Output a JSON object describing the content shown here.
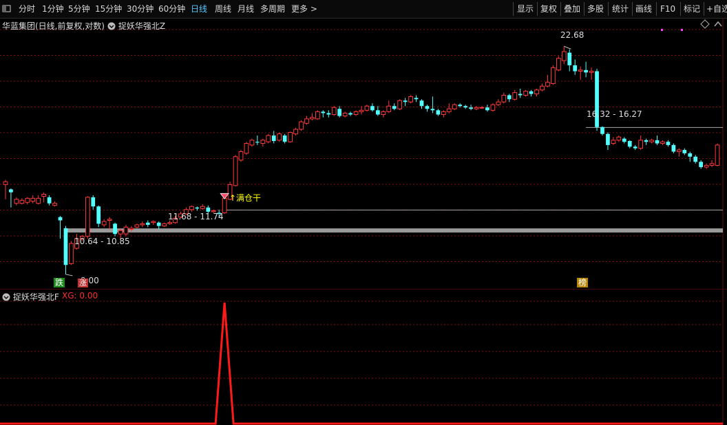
{
  "toolbar": {
    "periods": [
      "分时",
      "1分钟",
      "5分钟",
      "15分钟",
      "30分钟",
      "60分钟",
      "日线",
      "周线",
      "月线",
      "多周期",
      "更多"
    ],
    "active": "日线",
    "more_arrow": ">",
    "tools": [
      "显示",
      "复权",
      "叠加",
      "多股",
      "统计",
      "画线",
      "F10",
      "标记",
      "+自选"
    ]
  },
  "main": {
    "stock_title": "华蓝集团(日线,前复权,对数)",
    "indicator_name": "捉妖华强北Z",
    "labels": {
      "high": "22.68",
      "range_a": "16.32 - 16.27",
      "range_b": "11.68 - 11.74",
      "range_c": "10.64 - 10.85",
      "low": "9.00",
      "signal": "↑满仓干",
      "badge_die": "跌",
      "badge_zhang": "涨",
      "badge_bang": "榜"
    }
  },
  "sub": {
    "indicator_name": "捉妖华强北F",
    "value_label": "XG: 0.00"
  },
  "colors": {
    "up": "#ff3b3b",
    "down": "#54ffff",
    "grid": "#8a1010",
    "active_tab": "#56c8ff",
    "signal_text": "#ffff00",
    "xg_label": "#ff2d2d"
  },
  "chart_data": {
    "type": "candlestick",
    "scale": "log",
    "ylim": [
      8.8,
      24.0
    ],
    "candles": [
      [
        12.95,
        13.1,
        12.2,
        13.2
      ],
      [
        12.7,
        12.55,
        11.8,
        12.75
      ],
      [
        12.0,
        12.2,
        11.9,
        12.3
      ],
      [
        12.0,
        12.15,
        11.95,
        12.25
      ],
      [
        12.05,
        12.25,
        11.95,
        12.3
      ],
      [
        12.1,
        12.25,
        12.0,
        12.4
      ],
      [
        12.0,
        12.25,
        11.95,
        12.4
      ],
      [
        12.35,
        12.45,
        12.05,
        12.55
      ],
      [
        12.3,
        12.0,
        11.9,
        12.4
      ],
      [
        11.9,
        12.0,
        11.85,
        12.1
      ],
      [
        11.35,
        11.2,
        10.4,
        11.4
      ],
      [
        10.85,
        9.35,
        9.0,
        10.95
      ],
      [
        9.4,
        10.2,
        9.35,
        10.3
      ],
      [
        10.0,
        10.4,
        9.95,
        10.6
      ],
      [
        10.4,
        10.5,
        10.3,
        10.55
      ],
      [
        10.5,
        12.3,
        10.4,
        12.35
      ],
      [
        12.3,
        11.85,
        11.7,
        12.4
      ],
      [
        11.85,
        11.05,
        10.9,
        11.9
      ],
      [
        11.0,
        11.15,
        10.9,
        11.25
      ],
      [
        11.2,
        11.25,
        10.8,
        11.35
      ],
      [
        11.05,
        10.6,
        10.5,
        11.1
      ],
      [
        10.6,
        10.75,
        10.4,
        10.85
      ],
      [
        10.6,
        10.9,
        10.5,
        11.0
      ],
      [
        10.8,
        10.85,
        10.7,
        10.95
      ],
      [
        10.9,
        11.0,
        10.85,
        11.05
      ],
      [
        11.0,
        11.05,
        10.9,
        11.15
      ],
      [
        11.1,
        11.0,
        10.9,
        11.2
      ],
      [
        11.1,
        11.15,
        11.0,
        11.2
      ],
      [
        11.1,
        10.95,
        10.8,
        11.15
      ],
      [
        10.95,
        11.05,
        10.9,
        11.1
      ],
      [
        11.05,
        11.1,
        11.0,
        11.2
      ],
      [
        11.1,
        11.3,
        11.05,
        11.4
      ],
      [
        11.35,
        11.5,
        11.3,
        11.6
      ],
      [
        11.5,
        11.7,
        11.45,
        11.8
      ],
      [
        11.7,
        11.85,
        11.6,
        11.9
      ],
      [
        11.8,
        11.75,
        11.65,
        11.85
      ],
      [
        11.75,
        11.85,
        11.7,
        11.95
      ],
      [
        11.8,
        11.6,
        11.5,
        11.9
      ],
      [
        11.6,
        11.65,
        11.55,
        11.7
      ],
      [
        11.55,
        11.5,
        11.35,
        11.7
      ],
      [
        11.55,
        12.25,
        11.5,
        12.35
      ],
      [
        12.2,
        12.95,
        12.15,
        13.1
      ],
      [
        12.9,
        14.5,
        12.85,
        14.6
      ],
      [
        14.3,
        14.8,
        14.2,
        14.9
      ],
      [
        14.7,
        15.3,
        14.6,
        15.4
      ],
      [
        15.2,
        15.5,
        15.1,
        15.6
      ],
      [
        15.4,
        15.35,
        15.2,
        15.8
      ],
      [
        15.3,
        15.5,
        15.1,
        15.6
      ],
      [
        15.4,
        15.8,
        15.3,
        15.9
      ],
      [
        15.8,
        15.45,
        15.3,
        16.1
      ],
      [
        15.5,
        15.9,
        15.4,
        16.0
      ],
      [
        15.8,
        15.4,
        15.3,
        15.9
      ],
      [
        15.4,
        16.0,
        15.35,
        16.05
      ],
      [
        15.9,
        16.2,
        15.8,
        16.3
      ],
      [
        16.2,
        16.7,
        16.1,
        16.8
      ],
      [
        16.6,
        16.9,
        16.5,
        17.1
      ],
      [
        16.9,
        17.0,
        16.8,
        17.3
      ],
      [
        16.9,
        17.4,
        16.85,
        17.5
      ],
      [
        17.4,
        17.3,
        17.0,
        17.5
      ],
      [
        17.3,
        17.2,
        17.0,
        17.5
      ],
      [
        17.2,
        17.7,
        17.1,
        17.8
      ],
      [
        17.6,
        17.1,
        17.0,
        17.8
      ],
      [
        17.1,
        17.3,
        17.0,
        17.4
      ],
      [
        17.3,
        17.2,
        17.1,
        17.4
      ],
      [
        17.2,
        17.4,
        17.1,
        17.5
      ],
      [
        17.4,
        17.5,
        17.2,
        17.8
      ],
      [
        17.5,
        17.8,
        17.4,
        17.9
      ],
      [
        17.8,
        17.5,
        17.4,
        18.0
      ],
      [
        17.5,
        17.2,
        17.1,
        17.8
      ],
      [
        17.2,
        17.4,
        17.0,
        17.5
      ],
      [
        17.4,
        17.8,
        17.3,
        18.2
      ],
      [
        17.8,
        17.6,
        17.5,
        18.0
      ],
      [
        17.6,
        18.2,
        17.5,
        18.3
      ],
      [
        18.2,
        18.1,
        17.8,
        18.4
      ],
      [
        18.1,
        18.5,
        18.0,
        18.6
      ],
      [
        18.4,
        18.3,
        18.1,
        18.6
      ],
      [
        18.2,
        17.8,
        17.6,
        18.3
      ],
      [
        17.8,
        17.6,
        17.4,
        17.9
      ],
      [
        17.6,
        17.5,
        17.3,
        18.5
      ],
      [
        17.5,
        17.2,
        17.1,
        17.6
      ],
      [
        17.2,
        17.4,
        17.0,
        17.5
      ],
      [
        17.4,
        17.6,
        17.3,
        18.0
      ],
      [
        17.6,
        17.9,
        17.5,
        18.0
      ],
      [
        17.9,
        17.8,
        17.7,
        18.0
      ],
      [
        17.8,
        17.7,
        17.6,
        17.9
      ],
      [
        17.7,
        17.6,
        17.5,
        17.9
      ],
      [
        17.6,
        17.7,
        17.5,
        17.8
      ],
      [
        17.7,
        17.7,
        17.6,
        17.8
      ],
      [
        17.7,
        17.5,
        17.4,
        17.9
      ],
      [
        17.5,
        17.9,
        17.4,
        18.0
      ],
      [
        17.9,
        18.1,
        17.8,
        18.3
      ],
      [
        18.1,
        18.6,
        18.0,
        18.8
      ],
      [
        18.6,
        18.3,
        18.1,
        18.7
      ],
      [
        18.3,
        18.8,
        18.2,
        19.0
      ],
      [
        18.7,
        18.6,
        18.4,
        19.1
      ],
      [
        18.6,
        18.9,
        18.5,
        19.0
      ],
      [
        18.9,
        18.7,
        18.5,
        19.0
      ],
      [
        18.7,
        19.0,
        18.5,
        19.1
      ],
      [
        19.0,
        19.3,
        18.9,
        19.5
      ],
      [
        19.3,
        19.6,
        19.2,
        20.2
      ],
      [
        19.5,
        20.8,
        19.4,
        21.0
      ],
      [
        20.6,
        21.6,
        20.5,
        21.8
      ],
      [
        21.4,
        22.2,
        21.1,
        22.68
      ],
      [
        22.1,
        21.0,
        20.5,
        22.4
      ],
      [
        21.0,
        20.5,
        20.2,
        21.5
      ],
      [
        20.5,
        20.6,
        19.8,
        20.9
      ],
      [
        20.6,
        20.4,
        20.0,
        21.3
      ],
      [
        20.4,
        20.5,
        19.8,
        20.8
      ],
      [
        20.5,
        16.35,
        16.1,
        20.7
      ],
      [
        16.35,
        15.9,
        15.8,
        16.4
      ],
      [
        15.9,
        15.2,
        14.9,
        16.0
      ],
      [
        15.3,
        15.5,
        15.2,
        15.7
      ],
      [
        15.5,
        15.7,
        15.4,
        15.8
      ],
      [
        15.6,
        15.4,
        15.3,
        15.7
      ],
      [
        15.45,
        15.1,
        15.0,
        15.5
      ],
      [
        15.1,
        15.0,
        14.9,
        15.2
      ],
      [
        15.0,
        15.5,
        14.9,
        15.8
      ],
      [
        15.5,
        15.4,
        15.2,
        15.6
      ],
      [
        15.4,
        15.5,
        15.3,
        15.6
      ],
      [
        15.5,
        15.3,
        15.2,
        15.8
      ],
      [
        15.3,
        15.4,
        15.2,
        15.5
      ],
      [
        15.4,
        15.2,
        15.1,
        15.5
      ],
      [
        15.2,
        14.8,
        14.7,
        15.3
      ],
      [
        14.8,
        14.9,
        14.5,
        15.0
      ],
      [
        14.9,
        14.7,
        14.6,
        15.0
      ],
      [
        14.7,
        14.5,
        14.2,
        14.8
      ],
      [
        14.5,
        14.2,
        14.1,
        14.6
      ],
      [
        14.2,
        13.9,
        13.8,
        14.3
      ],
      [
        13.9,
        14.0,
        13.8,
        14.1
      ],
      [
        14.0,
        14.1,
        13.9,
        14.3
      ],
      [
        14.0,
        15.2,
        13.95,
        15.3
      ]
    ],
    "hlines": [
      22.68,
      16.32,
      11.68,
      10.75
    ],
    "sub_series": {
      "name": "XG",
      "ylim": [
        0,
        1.2
      ],
      "peak_index": 40,
      "peak_value": 1
    }
  }
}
